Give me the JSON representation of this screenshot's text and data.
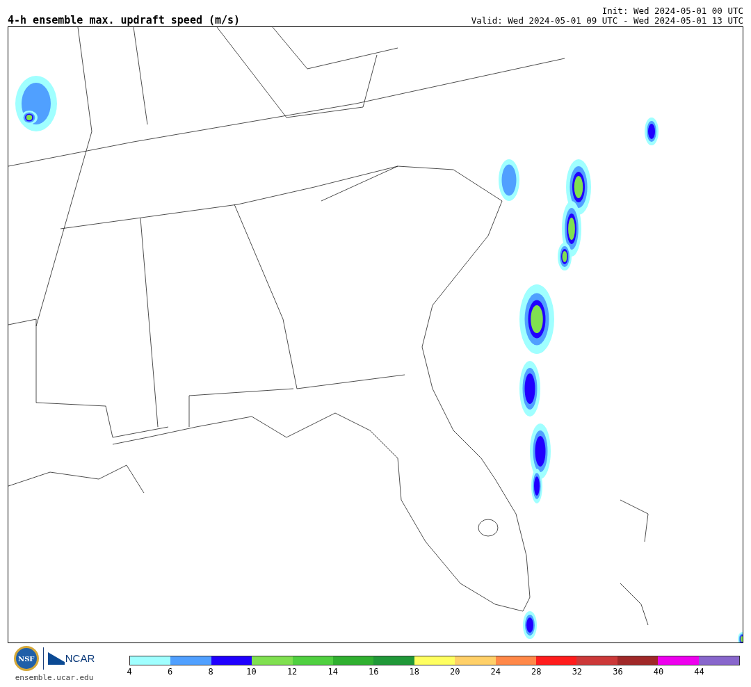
{
  "header": {
    "title": "4-h ensemble max. updraft speed (m/s)",
    "init": "Init: Wed 2024-05-01 00 UTC",
    "valid": "Valid: Wed 2024-05-01 09 UTC - Wed 2024-05-01 13 UTC"
  },
  "footer": {
    "nsf_logo": "NSF",
    "ncar_logo": "NCAR",
    "website": "ensemble.ucar.edu"
  },
  "colorbar": {
    "segments": [
      {
        "color": "#a0ffff"
      },
      {
        "color": "#50a0ff"
      },
      {
        "color": "#2000ff"
      },
      {
        "color": "#80e050"
      },
      {
        "color": "#50d040"
      },
      {
        "color": "#30b030"
      },
      {
        "color": "#209838"
      },
      {
        "color": "#ffff60"
      },
      {
        "color": "#ffd068"
      },
      {
        "color": "#ff8848"
      },
      {
        "color": "#ff1c1c"
      },
      {
        "color": "#cc3838"
      },
      {
        "color": "#a02828"
      },
      {
        "color": "#ee00ee"
      },
      {
        "color": "#8866cc"
      }
    ],
    "ticks": [
      "4",
      "6",
      "8",
      "10",
      "12",
      "14",
      "16",
      "18",
      "20",
      "24",
      "28",
      "32",
      "36",
      "40",
      "44"
    ]
  }
}
